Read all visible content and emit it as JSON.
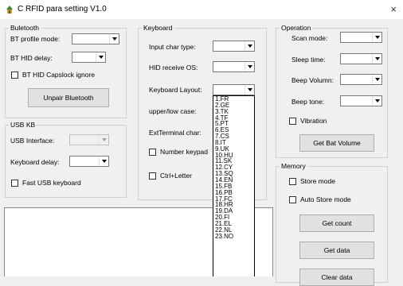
{
  "window": {
    "title": "C RFID para setting V1.0",
    "close_glyph": "×",
    "icon": "app-icon"
  },
  "bluetooth": {
    "legend": "Buletooth",
    "profile_label": "BT profile mode:",
    "profile_value": "",
    "hid_delay_label": "BT HID delay:",
    "hid_delay_value": "",
    "capslock_label": "BT HID Capslock ignore",
    "capslock_checked": false,
    "unpair_button": "Unpair Bluetooth"
  },
  "usb": {
    "legend": "USB KB",
    "interface_label": "USB Interface:",
    "interface_value": "",
    "kb_delay_label": "Keyboard delay:",
    "kb_delay_value": "",
    "fast_label": "Fast USB keyboard",
    "fast_checked": false
  },
  "keyboard": {
    "legend": "Keyboard",
    "input_char_label": "Input char type:",
    "hid_os_label": "HID receive OS:",
    "layout_label": "Keyboard Layout:",
    "case_label": "upper/low case:",
    "ext_label": "ExtTerminal char:",
    "number_label": "Number keypad",
    "ctrl_label": "Ctrl+Letter",
    "layout_options": [
      "1.FR",
      "2.GE",
      "3.TK",
      "4.TF",
      "5.PT",
      "6.ES",
      "7.CS",
      "8.IT",
      "9.UK",
      "10.HU",
      "11.SK",
      "12.CY",
      "13.SQ",
      "14.EN",
      "15.FB",
      "16.PB",
      "17.FC",
      "18.HR",
      "19.DA",
      "20.FI",
      "21.EL",
      "22.NL",
      "23.NO"
    ]
  },
  "operation": {
    "legend": "Operation",
    "scan_label": "Scan mode:",
    "sleep_label": "Sleep time:",
    "beep_vol_label": "Beep Volumn:",
    "beep_tone_label": "Beep tone:",
    "vibration_label": "Vibration",
    "bat_button": "Get Bat Volume"
  },
  "memory": {
    "legend": "Memory",
    "store_label": "Store mode",
    "auto_store_label": "Auto Store mode",
    "count_button": "Get count",
    "data_button": "Get data",
    "clear_button": "Clear data"
  },
  "log": {
    "text": ""
  }
}
